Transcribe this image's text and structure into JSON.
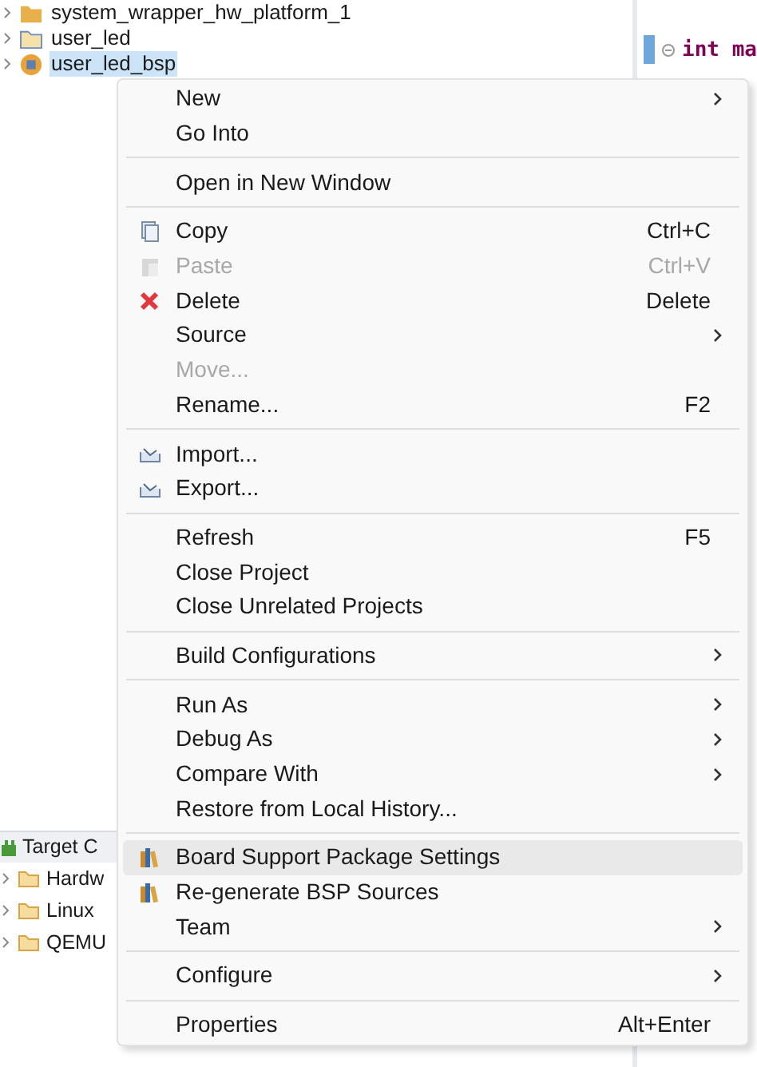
{
  "project_tree": [
    {
      "label": "system_wrapper_hw_platform_1",
      "selected": false
    },
    {
      "label": "user_led",
      "selected": false
    },
    {
      "label": "user_led_bsp",
      "selected": true
    }
  ],
  "editor": {
    "code_line": "int ma"
  },
  "target_panel": {
    "title": "Target C",
    "items": [
      {
        "label": "Hardw"
      },
      {
        "label": "Linux"
      },
      {
        "label": "QEMU"
      }
    ]
  },
  "context_menu": [
    {
      "kind": "item",
      "label": "New",
      "submenu": true,
      "disabled": false,
      "selected": false
    },
    {
      "kind": "item",
      "label": "Go Into",
      "submenu": false,
      "disabled": false,
      "selected": false
    },
    {
      "kind": "separator"
    },
    {
      "kind": "item",
      "label": "Open in New Window",
      "submenu": false,
      "disabled": false,
      "selected": false
    },
    {
      "kind": "separator"
    },
    {
      "kind": "item",
      "label": "Copy",
      "shortcut": "Ctrl+C",
      "submenu": false,
      "disabled": false,
      "selected": false
    },
    {
      "kind": "item",
      "label": "Paste",
      "shortcut": "Ctrl+V",
      "submenu": false,
      "disabled": true,
      "selected": false
    },
    {
      "kind": "item",
      "label": "Delete",
      "shortcut": "Delete",
      "submenu": false,
      "disabled": false,
      "selected": false
    },
    {
      "kind": "item",
      "label": "Source",
      "submenu": true,
      "disabled": false,
      "selected": false
    },
    {
      "kind": "item",
      "label": "Move...",
      "submenu": false,
      "disabled": true,
      "selected": false
    },
    {
      "kind": "item",
      "label": "Rename...",
      "shortcut": "F2",
      "submenu": false,
      "disabled": false,
      "selected": false
    },
    {
      "kind": "separator"
    },
    {
      "kind": "item",
      "label": "Import...",
      "submenu": false,
      "disabled": false,
      "selected": false
    },
    {
      "kind": "item",
      "label": "Export...",
      "submenu": false,
      "disabled": false,
      "selected": false
    },
    {
      "kind": "separator"
    },
    {
      "kind": "item",
      "label": "Refresh",
      "shortcut": "F5",
      "submenu": false,
      "disabled": false,
      "selected": false
    },
    {
      "kind": "item",
      "label": "Close Project",
      "submenu": false,
      "disabled": false,
      "selected": false
    },
    {
      "kind": "item",
      "label": "Close Unrelated Projects",
      "submenu": false,
      "disabled": false,
      "selected": false
    },
    {
      "kind": "separator"
    },
    {
      "kind": "item",
      "label": "Build Configurations",
      "submenu": true,
      "disabled": false,
      "selected": false
    },
    {
      "kind": "separator"
    },
    {
      "kind": "item",
      "label": "Run As",
      "submenu": true,
      "disabled": false,
      "selected": false
    },
    {
      "kind": "item",
      "label": "Debug As",
      "submenu": true,
      "disabled": false,
      "selected": false
    },
    {
      "kind": "item",
      "label": "Compare With",
      "submenu": true,
      "disabled": false,
      "selected": false
    },
    {
      "kind": "item",
      "label": "Restore from Local History...",
      "submenu": false,
      "disabled": false,
      "selected": false
    },
    {
      "kind": "separator"
    },
    {
      "kind": "item",
      "label": "Board Support Package Settings",
      "submenu": false,
      "disabled": false,
      "selected": true
    },
    {
      "kind": "item",
      "label": "Re-generate BSP Sources",
      "submenu": false,
      "disabled": false,
      "selected": false
    },
    {
      "kind": "item",
      "label": "Team",
      "submenu": true,
      "disabled": false,
      "selected": false
    },
    {
      "kind": "separator"
    },
    {
      "kind": "item",
      "label": "Configure",
      "submenu": true,
      "disabled": false,
      "selected": false
    },
    {
      "kind": "separator"
    },
    {
      "kind": "item",
      "label": "Properties",
      "shortcut": "Alt+Enter",
      "submenu": false,
      "disabled": false,
      "selected": false
    }
  ]
}
